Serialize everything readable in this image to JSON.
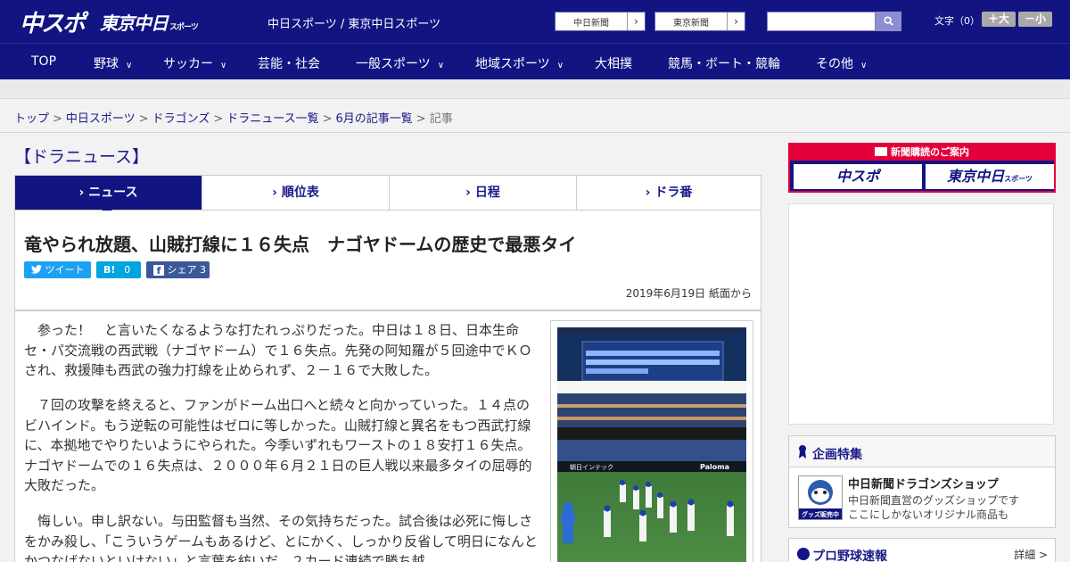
{
  "header": {
    "logo_chu": "中スポ",
    "logo_tokyo": "東京中日",
    "logo_tokyo_sub": "スポーツ",
    "site_names": "中日スポーツ / 東京中日スポーツ",
    "chunichi_link": "中日新聞",
    "tokyo_link": "東京新聞",
    "search_placeholder": "",
    "fontsize_label": "文字（0）",
    "font_larger": "＋大",
    "font_smaller": "－小"
  },
  "nav": [
    {
      "label": "TOP",
      "dropdown": false
    },
    {
      "label": "野球",
      "dropdown": true
    },
    {
      "label": "サッカー",
      "dropdown": true
    },
    {
      "label": "芸能・社会",
      "dropdown": false
    },
    {
      "label": "一般スポーツ",
      "dropdown": true
    },
    {
      "label": "地域スポーツ",
      "dropdown": true
    },
    {
      "label": "大相撲",
      "dropdown": false
    },
    {
      "label": "競馬・ボート・競輪",
      "dropdown": false
    },
    {
      "label": "その他",
      "dropdown": true
    }
  ],
  "breadcrumb": {
    "items": [
      "トップ",
      "中日スポーツ",
      "ドラゴンズ",
      "ドラニュース一覧",
      "6月の記事一覧"
    ],
    "current": "記事",
    "separator": ">"
  },
  "section_title": "【ドラニュース】",
  "tabs": [
    {
      "label": "ニュース",
      "active": true
    },
    {
      "label": "順位表",
      "active": false
    },
    {
      "label": "日程",
      "active": false
    },
    {
      "label": "ドラ番",
      "active": false
    }
  ],
  "article": {
    "headline": "竜やられ放題、山賊打線に１６失点　ナゴヤドームの歴史で最悪タイ",
    "share": {
      "tweet_label": "ツイート",
      "hatena_label": "B!",
      "hatena_count": "0",
      "facebook_label": "シェア",
      "facebook_count": "3"
    },
    "date": "2019年6月19日 紙面から",
    "paragraphs": [
      "参った！　と言いたくなるような打たれっぷりだった。中日は１８日、日本生命セ・パ交流戦の西武戦（ナゴヤドーム）で１６失点。先発の阿知羅が５回途中でＫＯされ、救援陣も西武の強力打線を止められず、２－１６で大敗した。",
      "７回の攻撃を終えると、ファンがドーム出口へと続々と向かっていった。１４点のビハインド。もう逆転の可能性はゼロに等しかった。山賊打線と異名をもつ西武打線に、本拠地でやりたいようにやられた。今季いずれもワーストの１８安打１６失点。ナゴヤドームでの１６失点は、２０００年６月２１日の巨人戦以来最多タイの屈辱的大敗だった。",
      "悔しい。申し訳ない。与田監督も当然、その気持ちだった。試合後は必死に悔しさをかみ殺し、「こういうゲームもあるけど、とにかく、しっかり反省して明日になんとかつなげないといけない」と言葉を紡いだ。２カード連続で勝ち越"
    ],
    "photo_sign_left": "朝日インテック",
    "photo_sign_right": "Paloma"
  },
  "sidebar": {
    "subscription_title": "新聞購読のご案内",
    "sub_logo_chu": "中スポ",
    "sub_logo_tokyo": "東京中日",
    "sub_logo_tokyo_sub": "スポーツ",
    "special_title": "企画特集",
    "special_item_name": "中日新聞ドラゴンズショップ",
    "special_item_desc1": "中日新聞直営のグッズショップです",
    "special_item_desc2": "ここにしかないオリジナル商品も",
    "special_thumb_text": "グッズ販売中",
    "baseball_title": "プロ野球速報",
    "baseball_more": "詳細 >"
  },
  "colors": {
    "brand_navy": "#121482",
    "accent_red": "#e3003a",
    "twitter": "#1da1f2",
    "hatena": "#00a4de",
    "facebook": "#3b5998"
  }
}
